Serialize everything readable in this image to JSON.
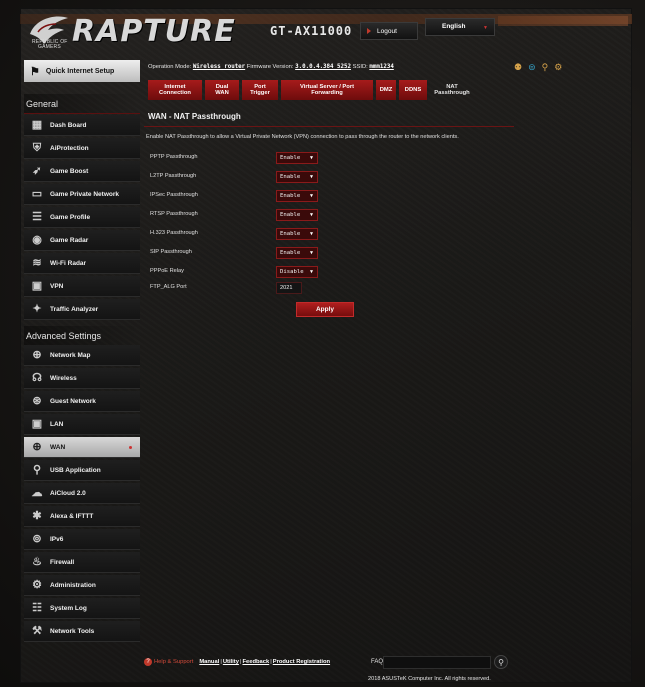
{
  "header": {
    "brand": "RAPTURE",
    "model": "GT-AX11000",
    "rog_text_line1": "REPUBLIC OF",
    "rog_text_line2": "GAMERS",
    "logout_label": "Logout",
    "language": "English"
  },
  "status_bar": {
    "op_mode_label": "Operation Mode:",
    "op_mode_value": "Wireless router",
    "firmware_label": "Firmware Version:",
    "firmware_value": "3.0.0.4.384_5252",
    "ssid_label": "SSID:",
    "ssid_value": "mmm1234"
  },
  "sidebar": {
    "quick_setup": "Quick Internet Setup",
    "general_title": "General",
    "general_items": [
      {
        "label": "Dash Board",
        "icon": "dashboard-icon",
        "glyph": "▦"
      },
      {
        "label": "AiProtection",
        "icon": "shield-lock-icon",
        "glyph": "⛨"
      },
      {
        "label": "Game Boost",
        "icon": "rocket-icon",
        "glyph": "➶"
      },
      {
        "label": "Game Private Network",
        "icon": "monitor-icon",
        "glyph": "▭"
      },
      {
        "label": "Game Profile",
        "icon": "profile-list-icon",
        "glyph": "☰"
      },
      {
        "label": "Game Radar",
        "icon": "radar-icon",
        "glyph": "◉"
      },
      {
        "label": "Wi-Fi Radar",
        "icon": "wifi-radar-icon",
        "glyph": "≋"
      },
      {
        "label": "VPN",
        "icon": "vpn-icon",
        "glyph": "▣"
      },
      {
        "label": "Traffic Analyzer",
        "icon": "traffic-analyzer-icon",
        "glyph": "✦"
      }
    ],
    "advanced_title": "Advanced Settings",
    "advanced_items": [
      {
        "label": "Network Map",
        "icon": "network-map-icon",
        "glyph": "⊕"
      },
      {
        "label": "Wireless",
        "icon": "wireless-icon",
        "glyph": "☊"
      },
      {
        "label": "Guest Network",
        "icon": "guest-network-icon",
        "glyph": "⊛"
      },
      {
        "label": "LAN",
        "icon": "lan-icon",
        "glyph": "▣"
      },
      {
        "label": "WAN",
        "icon": "globe-icon",
        "glyph": "⊕"
      },
      {
        "label": "USB Application",
        "icon": "usb-icon",
        "glyph": "⚲"
      },
      {
        "label": "AiCloud 2.0",
        "icon": "cloud-icon",
        "glyph": "☁"
      },
      {
        "label": "Alexa & IFTTT",
        "icon": "alexa-icon",
        "glyph": "✱"
      },
      {
        "label": "IPv6",
        "icon": "ipv6-icon",
        "glyph": "⊚"
      },
      {
        "label": "Firewall",
        "icon": "firewall-icon",
        "glyph": "♨"
      },
      {
        "label": "Administration",
        "icon": "administration-icon",
        "glyph": "⚙"
      },
      {
        "label": "System Log",
        "icon": "system-log-icon",
        "glyph": "☷"
      },
      {
        "label": "Network Tools",
        "icon": "network-tools-icon",
        "glyph": "⚒"
      }
    ]
  },
  "tabs": [
    {
      "label": "Internet\nConnection"
    },
    {
      "label": "Dual\nWAN"
    },
    {
      "label": "Port\nTrigger"
    },
    {
      "label": "Virtual Server / Port\nForwarding"
    },
    {
      "label": "DMZ"
    },
    {
      "label": "DDNS"
    },
    {
      "label": "NAT\nPassthrough"
    }
  ],
  "main": {
    "title": "WAN - NAT Passthrough",
    "description": "Enable NAT Passthrough to allow a Virtual Private Network (VPN) connection to pass through the router to the network clients.",
    "rows": [
      {
        "label": "PPTP Passthrough",
        "value": "Enable"
      },
      {
        "label": "L2TP Passthrough",
        "value": "Enable"
      },
      {
        "label": "IPSec Passthrough",
        "value": "Enable"
      },
      {
        "label": "RTSP Passthrough",
        "value": "Enable"
      },
      {
        "label": "H.323 Passthrough",
        "value": "Enable"
      },
      {
        "label": "SIP Passthrough",
        "value": "Enable"
      },
      {
        "label": "PPPoE Relay",
        "value": "Disable"
      }
    ],
    "ftp_label": "FTP_ALG Port",
    "ftp_value": "2021",
    "apply_label": "Apply"
  },
  "footer": {
    "help": "Help & Support",
    "manual": "Manual",
    "utility": "Utility",
    "feedback": "Feedback",
    "product_reg": "Product Registration",
    "separator": "|",
    "faq": "FAQ",
    "copyright": "2018 ASUSTeK Computer Inc. All rights reserved."
  },
  "colors": {
    "accent": "#a61b1b",
    "text": "#e6e6e6"
  }
}
